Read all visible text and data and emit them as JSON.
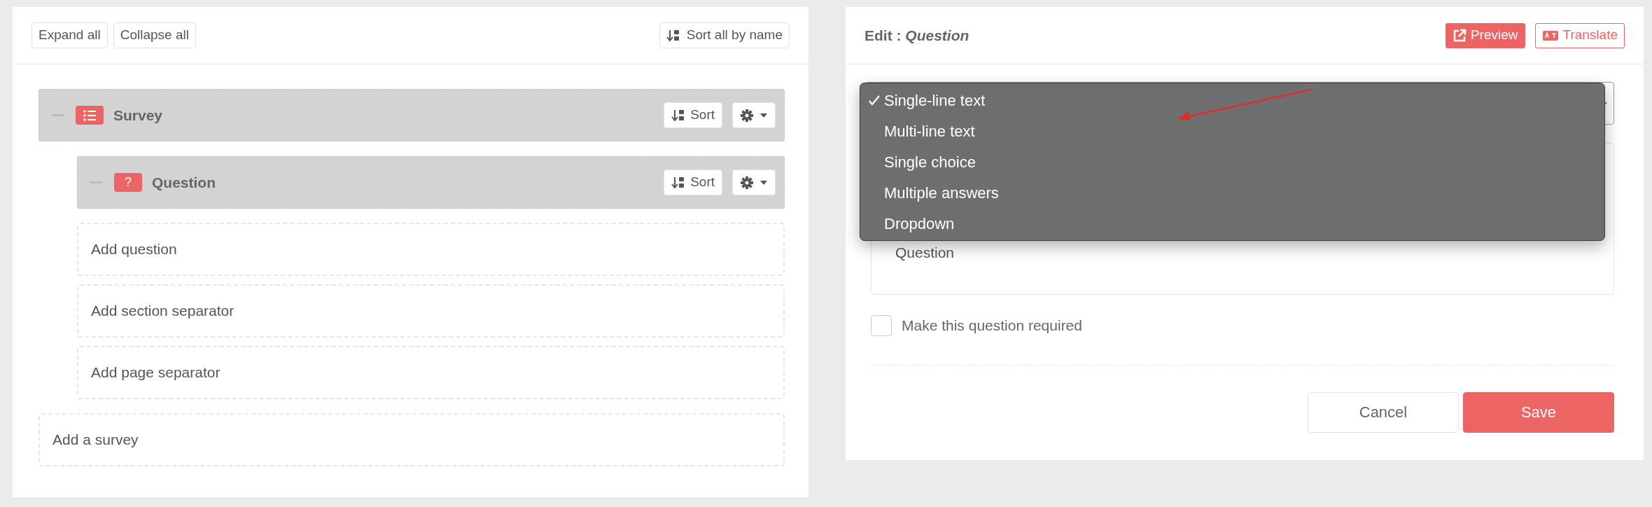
{
  "toolbar": {
    "buttons": [
      "Expand all",
      "Collapse all"
    ],
    "sort_button": "Sort all by name"
  },
  "tree": [
    {
      "kind": "survey",
      "title": "Survey",
      "sort_label": "Sort",
      "expanded": true,
      "children": [
        {
          "kind": "question",
          "badge": "?",
          "title": "Question",
          "sort_label": "Sort",
          "expanded": true
        }
      ],
      "add_items": [
        "Add question",
        "Add section separator",
        "Add page separator"
      ]
    }
  ],
  "add_root": "Add a survey",
  "editor": {
    "title_prefix": "Edit :",
    "title_subject": "Question",
    "preview": "Preview",
    "translate": "Translate",
    "type_options": [
      {
        "label": "Single-line text",
        "selected": true
      },
      {
        "label": "Multi-line text",
        "selected": false
      },
      {
        "label": "Single choice",
        "selected": false
      },
      {
        "label": "Multiple answers",
        "selected": false
      },
      {
        "label": "Dropdown",
        "selected": false
      }
    ],
    "question_text": "Question",
    "required": {
      "label": "Make this question required",
      "checked": false
    },
    "cancel": "Cancel",
    "save": "Save"
  }
}
